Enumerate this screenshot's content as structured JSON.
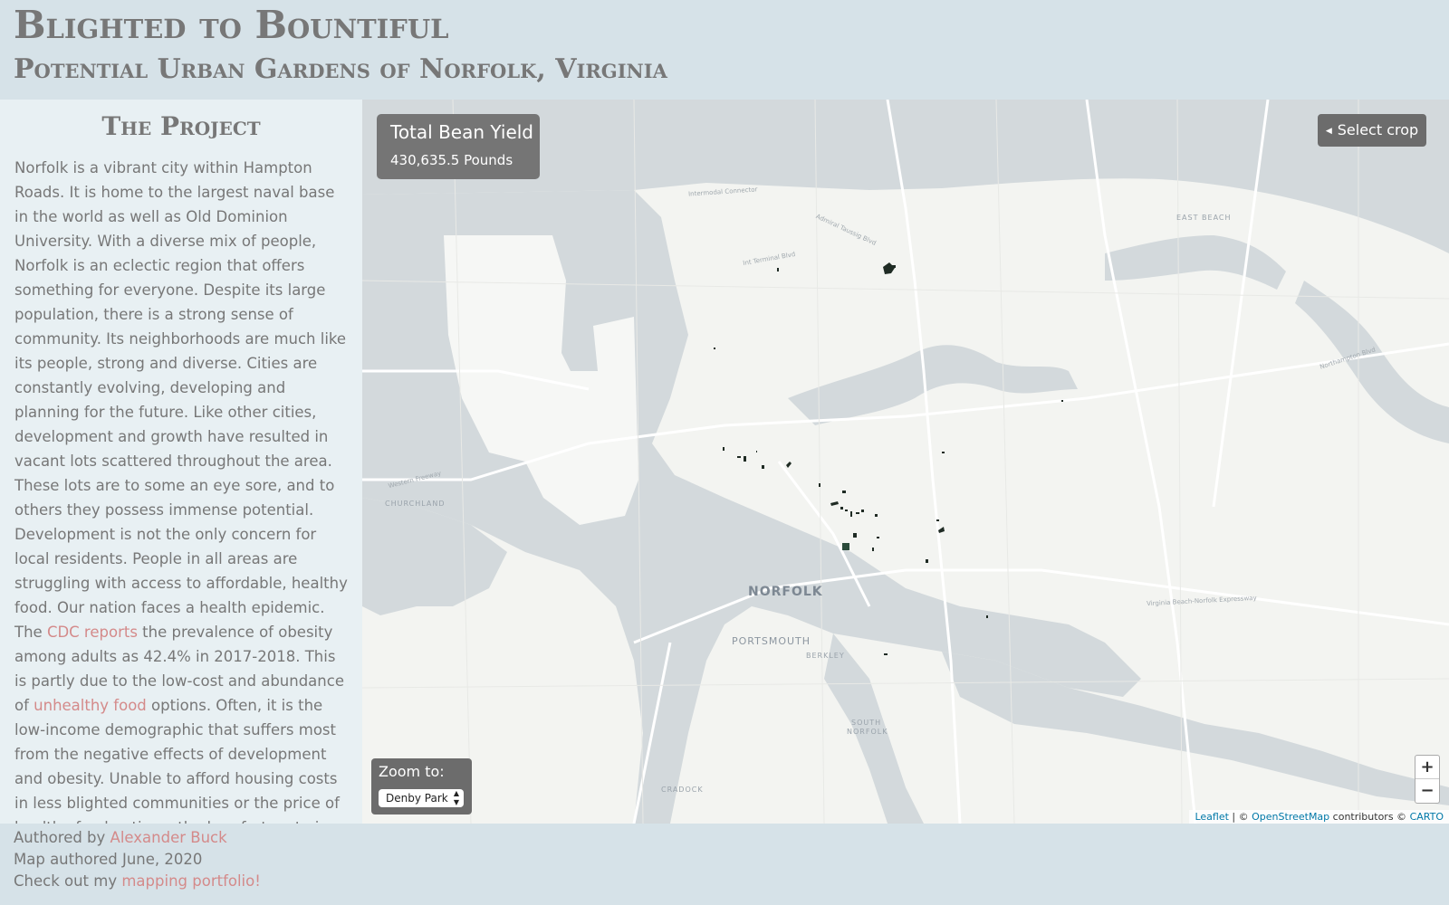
{
  "header": {
    "title": "Blighted to Bountiful",
    "subtitle": "Potential Urban Gardens of Norfolk, Virginia"
  },
  "sidebar": {
    "heading": "The Project",
    "text_1": "Norfolk is a vibrant city within Hampton Roads. It is home to the largest naval base in the world as well as Old Dominion University. With a diverse mix of people, Norfolk is an eclectic region that offers something for everyone. Despite its large population, there is a strong sense of community. Its neighborhoods are much like its people, strong and diverse. Cities are constantly evolving, developing and planning for the future. Like other cities, development and growth have resulted in vacant lots scattered throughout the area. These lots are to some an eye sore, and to others they possess immense potential. Development is not the only concern for local residents. People in all areas are struggling with access to affordable, healthy food. Our nation faces a health epidemic. The ",
    "link_cdc": "CDC reports",
    "text_2": " the prevalence of obesity among adults as 42.4% in 2017-2018. This is partly due to the low-cost and abundance of ",
    "link_food": "unhealthy food",
    "text_3": " options. Often, it is the low-income demographic that suffers most from the negative effects of development and obesity. Unable to afford housing costs in less blighted communities or the price of healthy food options, the less fortunate in our society bears"
  },
  "map": {
    "yield_title": "Total Bean Yield",
    "yield_value": "430,635.5 Pounds",
    "select_crop_label": "Select crop",
    "zoom_label": "Zoom to:",
    "zoom_selected": "Denby Park",
    "zoom_in": "+",
    "zoom_out": "−",
    "attribution": {
      "leaflet": "Leaflet",
      "sep": " | © ",
      "osm": "OpenStreetMap",
      "contrib": " contributors © ",
      "carto": "CARTO"
    },
    "place_labels": {
      "norfolk": "NORFOLK",
      "portsmouth": "PORTSMOUTH",
      "churchland": "CHURCHLAND",
      "berkley": "BERKLEY",
      "south_norfolk_1": "SOUTH",
      "south_norfolk_2": "NORFOLK",
      "cradock": "CRADOCK",
      "east_beach": "EAST BEACH"
    },
    "road_labels": {
      "intermodal": "Intermodal Connector",
      "admiral": "Admiral Taussig Blvd",
      "terminal": "Int Terminal Blvd",
      "northampton": "Northampton Blvd",
      "expressway": "Virginia Beach-Norfolk Expressway",
      "western": "Western Freeway"
    },
    "colors": {
      "water": "#d3d9dc",
      "land": "#f3f4f1",
      "parcel": "#1f2b24"
    }
  },
  "footer": {
    "authored_prefix": "Authored by ",
    "author": "Alexander Buck",
    "date": "Map authored June, 2020",
    "portfolio_prefix": "Check out my ",
    "portfolio_link": "mapping portfolio!"
  }
}
